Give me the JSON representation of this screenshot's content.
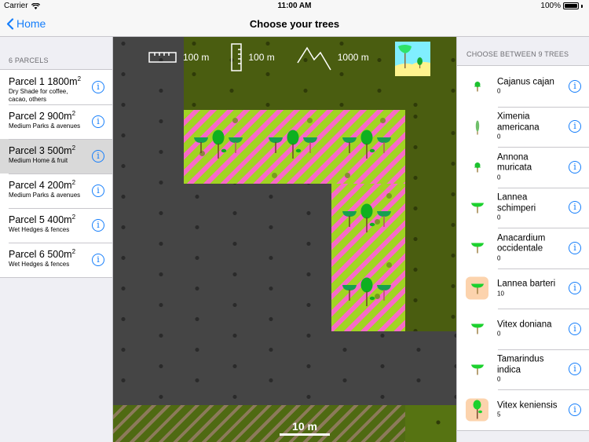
{
  "status_bar": {
    "carrier": "Carrier",
    "time": "11:00 AM",
    "battery": "100%",
    "battery_level": 1.0
  },
  "nav": {
    "back_label": "Home",
    "title": "Choose your trees"
  },
  "parcels": {
    "header": "6 PARCELS",
    "items": [
      {
        "name": "Parcel 1 1800m",
        "sup": "2",
        "subtitle": "Dry Shade for coffee, cacao, others",
        "selected": false
      },
      {
        "name": "Parcel 2 900m",
        "sup": "2",
        "subtitle": "Medium Parks & avenues",
        "selected": false
      },
      {
        "name": "Parcel 3 500m",
        "sup": "2",
        "subtitle": "Medium Home & fruit",
        "selected": true
      },
      {
        "name": "Parcel 4 200m",
        "sup": "2",
        "subtitle": "Medium Parks & avenues",
        "selected": false
      },
      {
        "name": "Parcel 5 400m",
        "sup": "2",
        "subtitle": "Wet Hedges & fences",
        "selected": false
      },
      {
        "name": "Parcel 6 500m",
        "sup": "2",
        "subtitle": "Wet Hedges & fences",
        "selected": false
      }
    ]
  },
  "map": {
    "toolbar": {
      "width_label": "100 m",
      "height_label": "100 m",
      "altitude_label": "1000 m"
    },
    "scale_label": "10 m",
    "colors": {
      "background": "#454545",
      "olive": "#4a5d10",
      "parcel_lime": "#a1d423",
      "parcel_pink": "#f86ac8",
      "bottom_brown": "#8c7a5a"
    }
  },
  "trees": {
    "header": "CHOOSE BETWEEN 9 TREES",
    "items": [
      {
        "name": "Cajanus cajan",
        "count": "0",
        "icon": "small-round-tree-icon",
        "selected": false
      },
      {
        "name": "Ximenia americana",
        "count": "0",
        "icon": "columnar-tree-icon",
        "selected": false
      },
      {
        "name": "Annona muricata",
        "count": "0",
        "icon": "small-round-tree-icon",
        "selected": false
      },
      {
        "name": "Lannea schimperi",
        "count": "0",
        "icon": "umbrella-tree-icon",
        "selected": false
      },
      {
        "name": "Anacardium occidentale",
        "count": "0",
        "icon": "umbrella-tree-icon",
        "selected": false
      },
      {
        "name": "Lannea barteri",
        "count": "10",
        "icon": "umbrella-tree-icon",
        "selected": true
      },
      {
        "name": "Vitex doniana",
        "count": "0",
        "icon": "umbrella-tree-icon",
        "selected": false
      },
      {
        "name": "Tamarindus indica",
        "count": "0",
        "icon": "umbrella-tree-icon",
        "selected": false
      },
      {
        "name": "Vitex keniensis",
        "count": "5",
        "icon": "round-tree-icon",
        "selected": true
      }
    ]
  },
  "colors": {
    "accent": "#157efb",
    "selected_row": "#d9d9d9",
    "selected_thumb": "#fcd3ad"
  }
}
